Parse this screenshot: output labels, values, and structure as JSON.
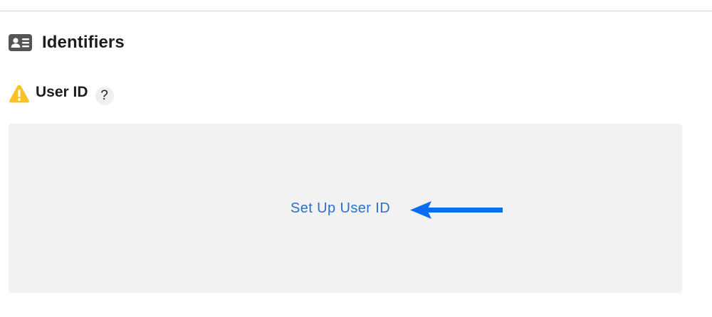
{
  "section": {
    "icon": "id-card-icon",
    "title": "Identifiers"
  },
  "field": {
    "warning_icon": "warning-icon",
    "label": "User ID",
    "help_label": "?"
  },
  "panel": {
    "link_label": "Set Up User ID",
    "link_color": "#2c6fce",
    "arrow_icon": "left-arrow-icon",
    "arrow_color": "#0a6cf0"
  },
  "colors": {
    "warning": "#f7c325",
    "panel_bg": "#f2f2f2",
    "icon_dark": "#555555"
  }
}
